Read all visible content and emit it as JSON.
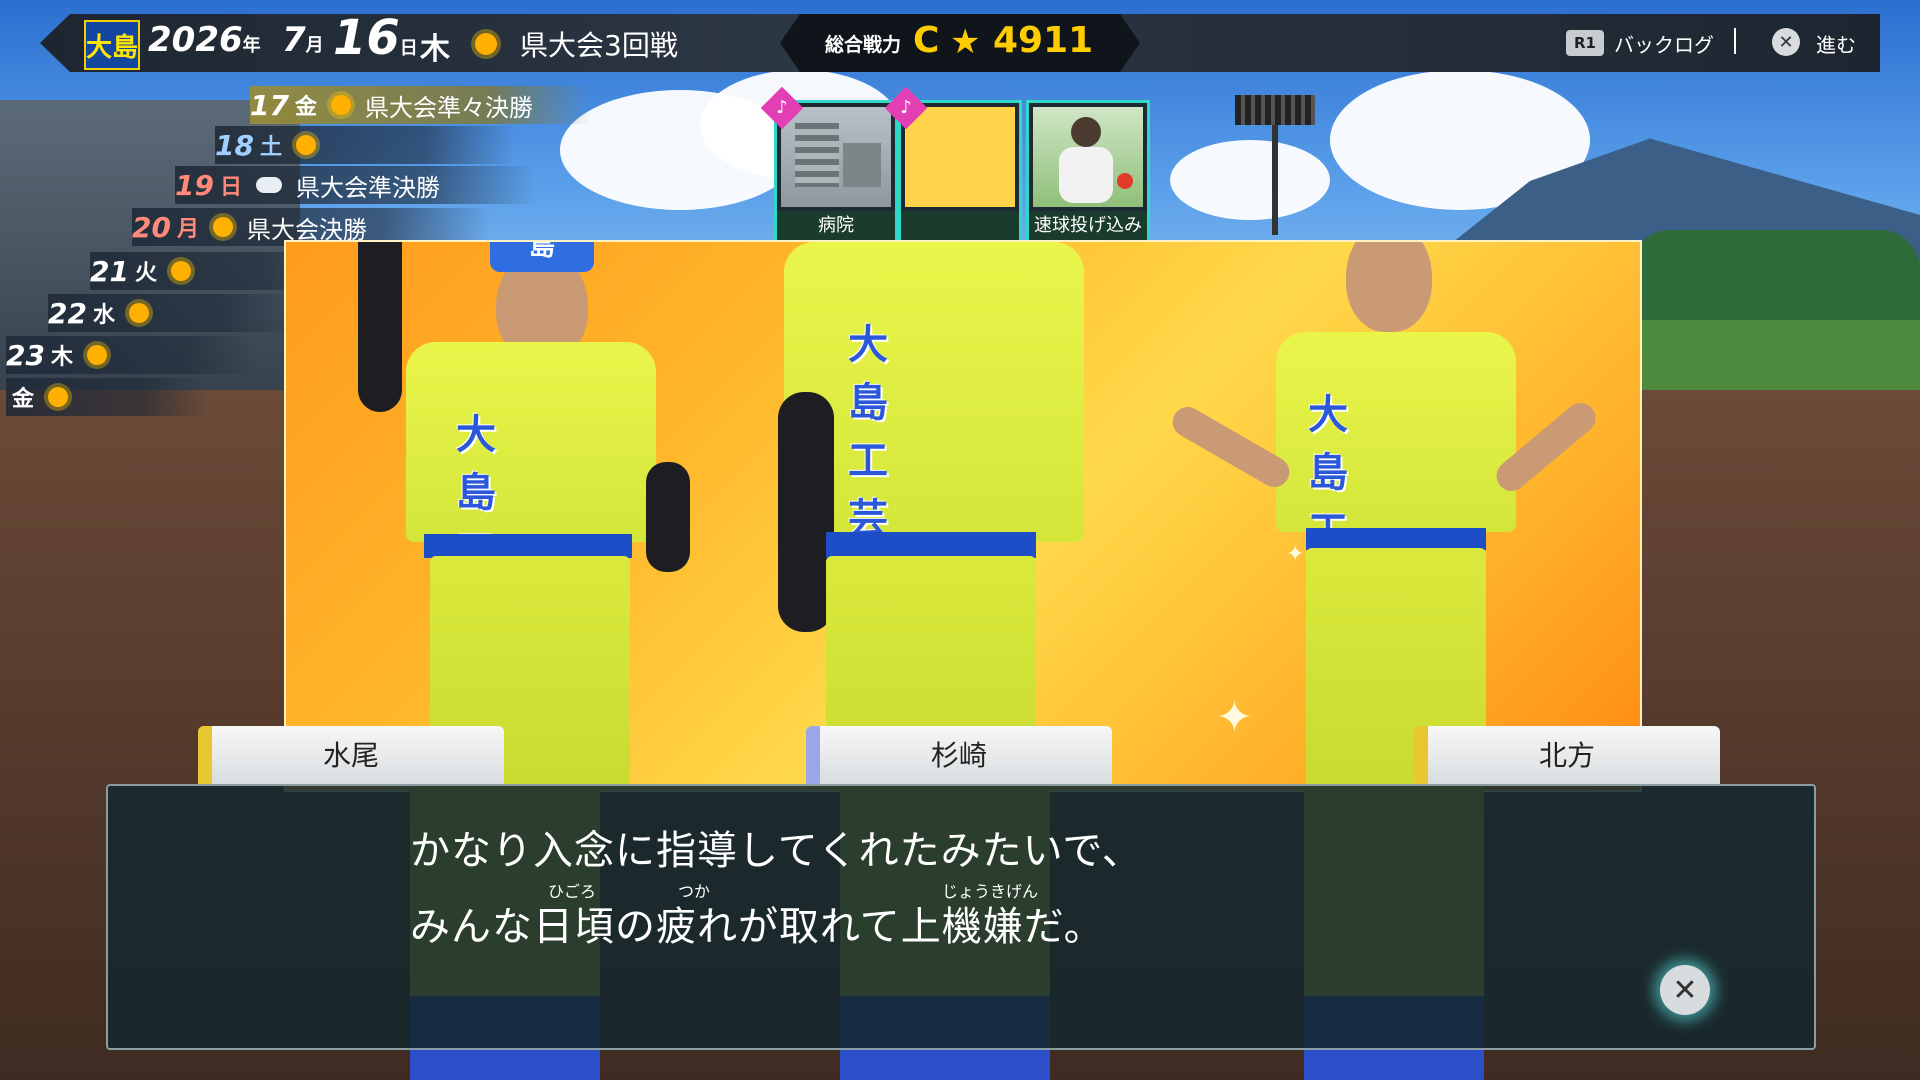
{
  "header": {
    "school_badge": "大島",
    "year": "2026",
    "year_unit": "年",
    "month": "7",
    "month_unit": "月",
    "day": "16",
    "day_unit": "日",
    "weekday": "木",
    "weather_icon": "sun-icon",
    "event": "県大会3回戦"
  },
  "team_power": {
    "label": "総合戦力",
    "grade": "C",
    "star": "★",
    "value": "4911"
  },
  "controls": {
    "backlog_button": "R1",
    "backlog_label": "バックログ",
    "advance_button_icon": "cross-icon",
    "advance_label": "進む"
  },
  "schedule": [
    {
      "day": "17",
      "dow": "金",
      "weather": "sun",
      "event": "県大会準々決勝"
    },
    {
      "day": "18",
      "dow": "土",
      "weather": "sun",
      "event": ""
    },
    {
      "day": "19",
      "dow": "日",
      "weather": "cloud",
      "event": "県大会準決勝"
    },
    {
      "day": "20",
      "dow": "月",
      "weather": "sun",
      "event": "県大会決勝"
    },
    {
      "day": "21",
      "dow": "火",
      "weather": "sun",
      "event": ""
    },
    {
      "day": "22",
      "dow": "水",
      "weather": "sun",
      "event": ""
    },
    {
      "day": "23",
      "dow": "木",
      "weather": "sun",
      "event": ""
    },
    {
      "day": "",
      "dow": "金",
      "weather": "sun",
      "event": ""
    }
  ],
  "cards": [
    {
      "label": "病院",
      "icon": "hospital-icon"
    },
    {
      "label": "",
      "icon": "player-portrait-icon"
    },
    {
      "label": "速球投げ込み",
      "icon": "pitcher-icon"
    }
  ],
  "stage": {
    "jersey_text": "大島工芸",
    "cap_logo": "島"
  },
  "characters": [
    {
      "name": "水尾"
    },
    {
      "name": "杉崎"
    },
    {
      "name": "北方"
    }
  ],
  "dialog": {
    "line1": "かなり入念に指導してくれたみたいで、",
    "line2": "みんな日頃の疲れが取れて上機嫌だ。",
    "ruby_higoro": "ひごろ",
    "ruby_tsuka": "つか",
    "ruby_joukigen": "じょうきげん"
  }
}
